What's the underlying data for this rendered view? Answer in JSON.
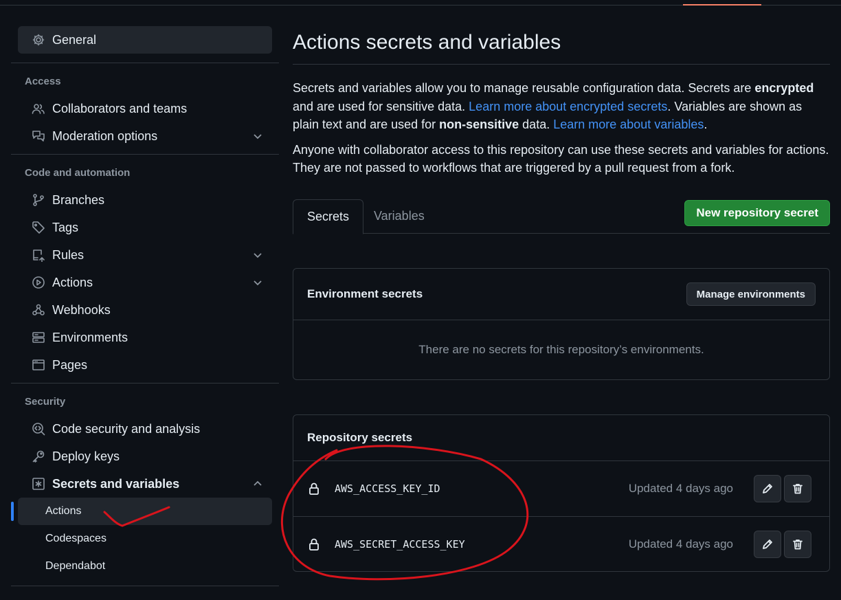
{
  "sidebar": {
    "general": {
      "label": "General",
      "icon": "gear-icon"
    },
    "sections": [
      {
        "heading": "Access",
        "items": [
          {
            "label": "Collaborators and teams",
            "icon": "people-icon"
          },
          {
            "label": "Moderation options",
            "icon": "comment-discussion-icon",
            "expandable": true
          }
        ]
      },
      {
        "heading": "Code and automation",
        "items": [
          {
            "label": "Branches",
            "icon": "branch-icon"
          },
          {
            "label": "Tags",
            "icon": "tag-icon"
          },
          {
            "label": "Rules",
            "icon": "repo-push-icon",
            "expandable": true
          },
          {
            "label": "Actions",
            "icon": "play-icon",
            "expandable": true
          },
          {
            "label": "Webhooks",
            "icon": "webhook-icon"
          },
          {
            "label": "Environments",
            "icon": "server-icon"
          },
          {
            "label": "Pages",
            "icon": "browser-icon"
          }
        ]
      },
      {
        "heading": "Security",
        "items": [
          {
            "label": "Code security and analysis",
            "icon": "codescan-icon"
          },
          {
            "label": "Deploy keys",
            "icon": "key-icon"
          },
          {
            "label": "Secrets and variables",
            "icon": "asterisk-icon",
            "expanded": true,
            "children": [
              {
                "label": "Actions",
                "selected": true
              },
              {
                "label": "Codespaces"
              },
              {
                "label": "Dependabot"
              }
            ]
          }
        ]
      }
    ]
  },
  "main": {
    "title": "Actions secrets and variables",
    "desc1_a": "Secrets and variables allow you to manage reusable configuration data. Secrets are ",
    "desc1_b": "encrypted",
    "desc1_c": " and are used for sensitive data. ",
    "link1": "Learn more about encrypted secrets",
    "desc1_d": ". Variables are shown as plain text and are used for ",
    "desc1_e": "non-sensitive",
    "desc1_f": " data. ",
    "link2": "Learn more about variables",
    "desc1_g": ".",
    "desc2": "Anyone with collaborator access to this repository can use these secrets and variables for actions. They are not passed to workflows that are triggered by a pull request from a fork.",
    "tabs": [
      {
        "label": "Secrets",
        "active": true
      },
      {
        "label": "Variables",
        "active": false
      }
    ],
    "new_secret_button": "New repository secret",
    "environment_secrets": {
      "title": "Environment secrets",
      "manage_button": "Manage environments",
      "empty_text": "There are no secrets for this repository’s environments."
    },
    "repository_secrets": {
      "title": "Repository secrets",
      "rows": [
        {
          "name": "AWS_ACCESS_KEY_ID",
          "updated": "Updated 4 days ago"
        },
        {
          "name": "AWS_SECRET_ACCESS_KEY",
          "updated": "Updated 4 days ago"
        }
      ]
    }
  },
  "colors": {
    "background": "#0d1117",
    "accent": "#2f81f7",
    "link": "#4493f8",
    "primary_button": "#238636",
    "annotation": "#d9141c"
  }
}
